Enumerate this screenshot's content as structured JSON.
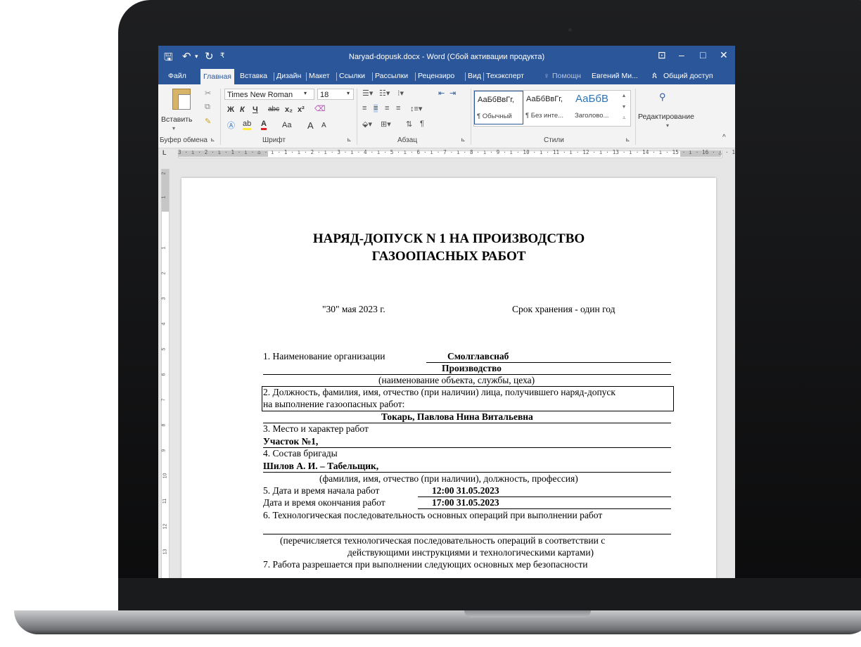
{
  "window": {
    "title": "Naryad-dopusk.docx - Word (Сбой активации продукта)",
    "quick_access": [
      "save-icon",
      "undo-icon",
      "redo-icon",
      "customize-icon"
    ]
  },
  "tabs": [
    "Файл",
    "Главная",
    "Вставка",
    "Дизайн",
    "Макет",
    "Ссылки",
    "Рассылки",
    "Рецензиро",
    "Вид",
    "Техэксперт"
  ],
  "active_tab": "Главная",
  "tell_me": "Помощн",
  "user": "Евгений Ми...",
  "share": "Общий доступ",
  "ribbon": {
    "paste_label": "Вставить",
    "clipboard_label": "Буфер обмена",
    "font_label": "Шрифт",
    "paragraph_label": "Абзац",
    "styles_label": "Стили",
    "editing_label": "Редактирование",
    "font_name": "Times New Roman",
    "font_size": "18",
    "bold": "Ж",
    "italic": "К",
    "underline": "Ч",
    "strike": "abc",
    "subscript": "x₂",
    "superscript": "x²",
    "change_case": "Aa",
    "grow_font": "A",
    "shrink_font": "A",
    "styles": [
      {
        "sample": "АаБбВвГг,",
        "name": "¶ Обычный"
      },
      {
        "sample": "АаБбВвГг,",
        "name": "¶ Без инте..."
      },
      {
        "sample": "АаБбВ",
        "name": "Заголово..."
      }
    ]
  },
  "ruler": {
    "tab_marker": "L",
    "scale": "3 · ı · 2 · ı · 1 · ı · ⌂ · ı · 1 · ı · 2 · ı · 3 · ı · 4 · ı · 5 · ı · 6 · ı · 7 · ı · 8 · ı · 9 · ı · 10 · ı · 11 · ı · 12 · ı · 13 · ı · 14 · ı · 15 · ı · 16 · △ · 17 · ı ·",
    "vticks": [
      "2",
      "1",
      "1",
      "2",
      "3",
      "4",
      "5",
      "6",
      "7",
      "8",
      "9",
      "10",
      "11",
      "12",
      "13"
    ]
  },
  "document": {
    "title_line1": "НАРЯД-ДОПУСК N 1 НА ПРОИЗВОДСТВО",
    "title_line2": "ГАЗООПАСНЫХ РАБОТ",
    "date": "\"30\" мая 2023 г.",
    "retention": "Срок хранения - один год",
    "org_label": "1. Наименование организации",
    "org_value": "Смолглавснаб",
    "dept_value": "Производство",
    "dept_hint": "(наименование объекта, службы, цеха)",
    "person_label1": "2. Должность, фамилия, имя, отчество (при наличии) лица, получившего наряд-допуск",
    "person_label2": "на выполнение газоопасных работ:",
    "person_value": "Токарь, Павлова Нина Витальевна",
    "place_label": "3. Место и характер работ",
    "place_value": "Участок №1,",
    "crew_label": "4. Состав бригады",
    "crew_value": "Шилов А. И. – Табельщик,",
    "crew_hint": "(фамилия, имя, отчество (при наличии), должность, профессия)",
    "start_label": "5. Дата и время начала работ",
    "start_value": "12:00 31.05.2023",
    "end_label": "Дата и время окончания работ",
    "end_value": "17:00 31.05.2023",
    "seq_label": "6. Технологическая последовательность основных операций при выполнении работ",
    "seq_hint1": "(перечисляется технологическая последовательность операций в соответствии с",
    "seq_hint2": "действующими инструкциями и технологическими картами)",
    "safety_label": "7. Работа разрешается при выполнении следующих основных мер безопасности"
  }
}
